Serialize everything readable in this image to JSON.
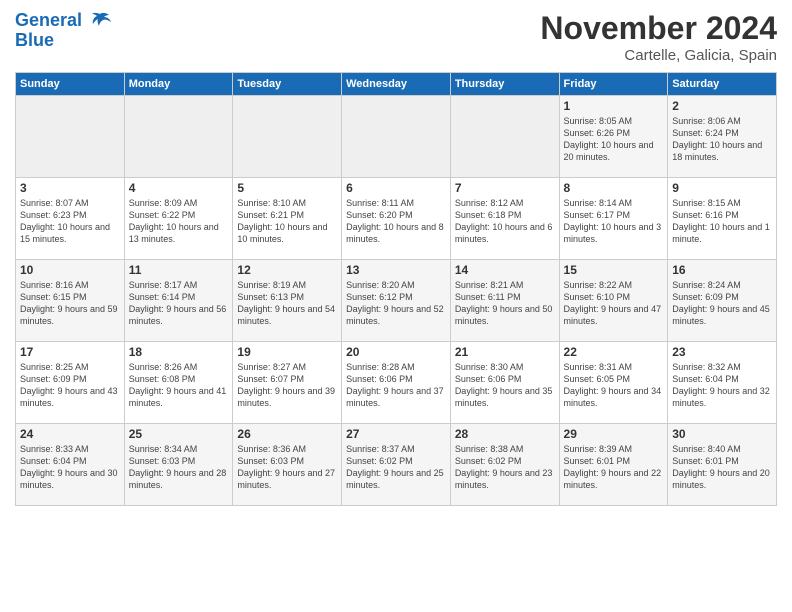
{
  "header": {
    "logo_line1": "General",
    "logo_line2": "Blue",
    "month": "November 2024",
    "location": "Cartelle, Galicia, Spain"
  },
  "days_of_week": [
    "Sunday",
    "Monday",
    "Tuesday",
    "Wednesday",
    "Thursday",
    "Friday",
    "Saturday"
  ],
  "weeks": [
    [
      {
        "day": "",
        "info": ""
      },
      {
        "day": "",
        "info": ""
      },
      {
        "day": "",
        "info": ""
      },
      {
        "day": "",
        "info": ""
      },
      {
        "day": "",
        "info": ""
      },
      {
        "day": "1",
        "info": "Sunrise: 8:05 AM\nSunset: 6:26 PM\nDaylight: 10 hours and 20 minutes."
      },
      {
        "day": "2",
        "info": "Sunrise: 8:06 AM\nSunset: 6:24 PM\nDaylight: 10 hours and 18 minutes."
      }
    ],
    [
      {
        "day": "3",
        "info": "Sunrise: 8:07 AM\nSunset: 6:23 PM\nDaylight: 10 hours and 15 minutes."
      },
      {
        "day": "4",
        "info": "Sunrise: 8:09 AM\nSunset: 6:22 PM\nDaylight: 10 hours and 13 minutes."
      },
      {
        "day": "5",
        "info": "Sunrise: 8:10 AM\nSunset: 6:21 PM\nDaylight: 10 hours and 10 minutes."
      },
      {
        "day": "6",
        "info": "Sunrise: 8:11 AM\nSunset: 6:20 PM\nDaylight: 10 hours and 8 minutes."
      },
      {
        "day": "7",
        "info": "Sunrise: 8:12 AM\nSunset: 6:18 PM\nDaylight: 10 hours and 6 minutes."
      },
      {
        "day": "8",
        "info": "Sunrise: 8:14 AM\nSunset: 6:17 PM\nDaylight: 10 hours and 3 minutes."
      },
      {
        "day": "9",
        "info": "Sunrise: 8:15 AM\nSunset: 6:16 PM\nDaylight: 10 hours and 1 minute."
      }
    ],
    [
      {
        "day": "10",
        "info": "Sunrise: 8:16 AM\nSunset: 6:15 PM\nDaylight: 9 hours and 59 minutes."
      },
      {
        "day": "11",
        "info": "Sunrise: 8:17 AM\nSunset: 6:14 PM\nDaylight: 9 hours and 56 minutes."
      },
      {
        "day": "12",
        "info": "Sunrise: 8:19 AM\nSunset: 6:13 PM\nDaylight: 9 hours and 54 minutes."
      },
      {
        "day": "13",
        "info": "Sunrise: 8:20 AM\nSunset: 6:12 PM\nDaylight: 9 hours and 52 minutes."
      },
      {
        "day": "14",
        "info": "Sunrise: 8:21 AM\nSunset: 6:11 PM\nDaylight: 9 hours and 50 minutes."
      },
      {
        "day": "15",
        "info": "Sunrise: 8:22 AM\nSunset: 6:10 PM\nDaylight: 9 hours and 47 minutes."
      },
      {
        "day": "16",
        "info": "Sunrise: 8:24 AM\nSunset: 6:09 PM\nDaylight: 9 hours and 45 minutes."
      }
    ],
    [
      {
        "day": "17",
        "info": "Sunrise: 8:25 AM\nSunset: 6:09 PM\nDaylight: 9 hours and 43 minutes."
      },
      {
        "day": "18",
        "info": "Sunrise: 8:26 AM\nSunset: 6:08 PM\nDaylight: 9 hours and 41 minutes."
      },
      {
        "day": "19",
        "info": "Sunrise: 8:27 AM\nSunset: 6:07 PM\nDaylight: 9 hours and 39 minutes."
      },
      {
        "day": "20",
        "info": "Sunrise: 8:28 AM\nSunset: 6:06 PM\nDaylight: 9 hours and 37 minutes."
      },
      {
        "day": "21",
        "info": "Sunrise: 8:30 AM\nSunset: 6:06 PM\nDaylight: 9 hours and 35 minutes."
      },
      {
        "day": "22",
        "info": "Sunrise: 8:31 AM\nSunset: 6:05 PM\nDaylight: 9 hours and 34 minutes."
      },
      {
        "day": "23",
        "info": "Sunrise: 8:32 AM\nSunset: 6:04 PM\nDaylight: 9 hours and 32 minutes."
      }
    ],
    [
      {
        "day": "24",
        "info": "Sunrise: 8:33 AM\nSunset: 6:04 PM\nDaylight: 9 hours and 30 minutes."
      },
      {
        "day": "25",
        "info": "Sunrise: 8:34 AM\nSunset: 6:03 PM\nDaylight: 9 hours and 28 minutes."
      },
      {
        "day": "26",
        "info": "Sunrise: 8:36 AM\nSunset: 6:03 PM\nDaylight: 9 hours and 27 minutes."
      },
      {
        "day": "27",
        "info": "Sunrise: 8:37 AM\nSunset: 6:02 PM\nDaylight: 9 hours and 25 minutes."
      },
      {
        "day": "28",
        "info": "Sunrise: 8:38 AM\nSunset: 6:02 PM\nDaylight: 9 hours and 23 minutes."
      },
      {
        "day": "29",
        "info": "Sunrise: 8:39 AM\nSunset: 6:01 PM\nDaylight: 9 hours and 22 minutes."
      },
      {
        "day": "30",
        "info": "Sunrise: 8:40 AM\nSunset: 6:01 PM\nDaylight: 9 hours and 20 minutes."
      }
    ]
  ]
}
